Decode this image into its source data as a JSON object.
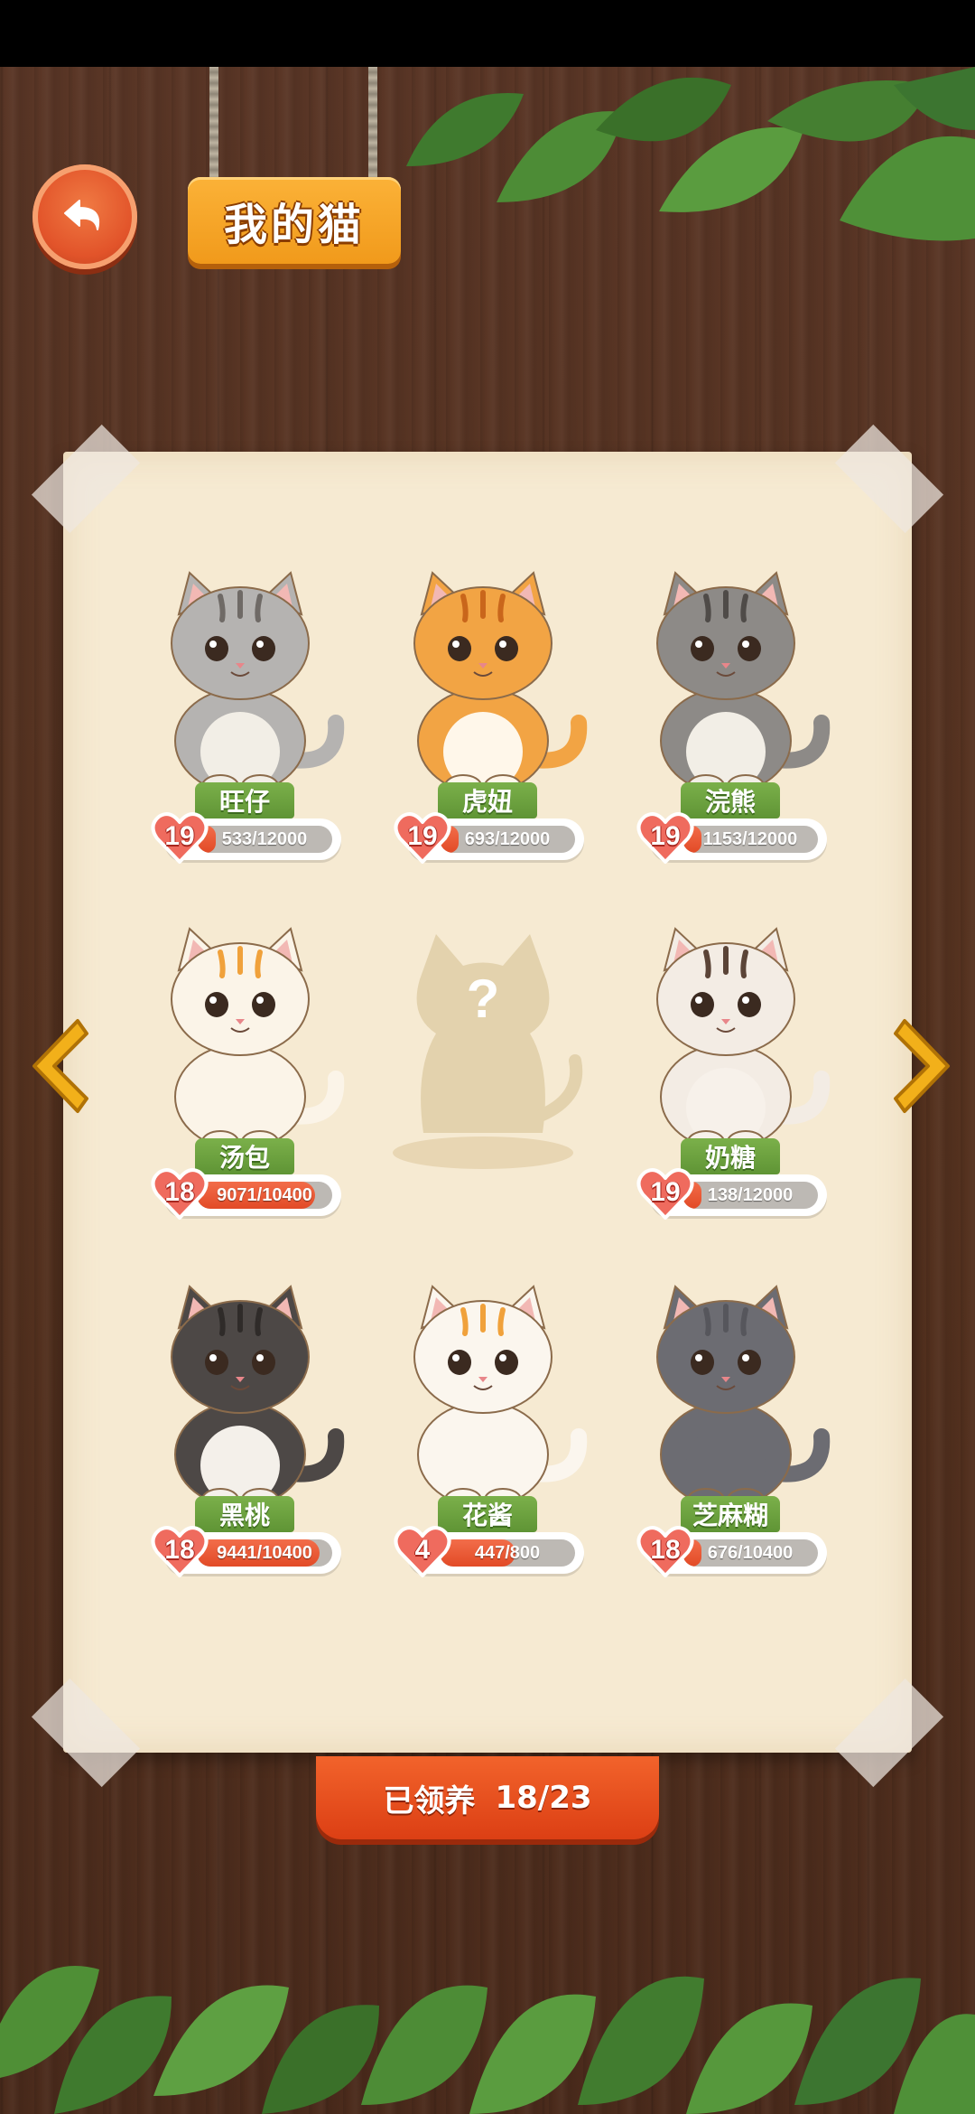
{
  "header": {
    "title": "我的猫"
  },
  "cats": [
    {
      "name": "旺仔",
      "level": "19",
      "progress_text": "533/12000",
      "progress": 0.044,
      "colors": {
        "fur": "#b5b3b1",
        "stripe": "#6f6a66",
        "belly": "#f2eee6"
      }
    },
    {
      "name": "虎妞",
      "level": "19",
      "progress_text": "693/12000",
      "progress": 0.058,
      "colors": {
        "fur": "#f2a444",
        "stripe": "#c9661b",
        "belly": "#fff7ea"
      }
    },
    {
      "name": "浣熊",
      "level": "19",
      "progress_text": "1153/12000",
      "progress": 0.096,
      "colors": {
        "fur": "#8d8a87",
        "stripe": "#4f4b48",
        "belly": "#f2eee6"
      }
    },
    {
      "name": "汤包",
      "level": "18",
      "progress_text": "9071/10400",
      "progress": 0.872,
      "colors": {
        "fur": "#fbf4e8",
        "stripe": "#f0a13b",
        "belly": "#fbf4e8"
      }
    },
    {
      "name": "",
      "level": "",
      "progress_text": "",
      "progress": 0,
      "locked": true,
      "locked_symbol": "?"
    },
    {
      "name": "奶糖",
      "level": "19",
      "progress_text": "138/12000",
      "progress": 0.012,
      "colors": {
        "fur": "#f3ece4",
        "stripe": "#5b4437",
        "belly": "#f7f1ea"
      }
    },
    {
      "name": "黑桃",
      "level": "18",
      "progress_text": "9441/10400",
      "progress": 0.908,
      "colors": {
        "fur": "#4d4846",
        "stripe": "#2f2b29",
        "belly": "#f4f0ea"
      }
    },
    {
      "name": "花酱",
      "level": "4",
      "progress_text": "447/800",
      "progress": 0.559,
      "colors": {
        "fur": "#fbf6ee",
        "stripe": "#f0a13b",
        "belly": "#fbf6ee"
      }
    },
    {
      "name": "芝麻糊",
      "level": "18",
      "progress_text": "676/10400",
      "progress": 0.065,
      "colors": {
        "fur": "#6c6c72",
        "stripe": "#56565c",
        "belly": "#6c6c72"
      }
    }
  ],
  "footer": {
    "adopted_label": "已领养",
    "adopted_count": "18/23"
  },
  "icons": {
    "back": "back-arrow-icon",
    "prev": "chevron-left-icon",
    "next": "chevron-right-icon",
    "heart": "heart-icon"
  },
  "theme": {
    "accent": "#e2542a",
    "name_tag": "#6fa240",
    "arrow": "#f2b01a",
    "paper": "#f6ead2"
  }
}
